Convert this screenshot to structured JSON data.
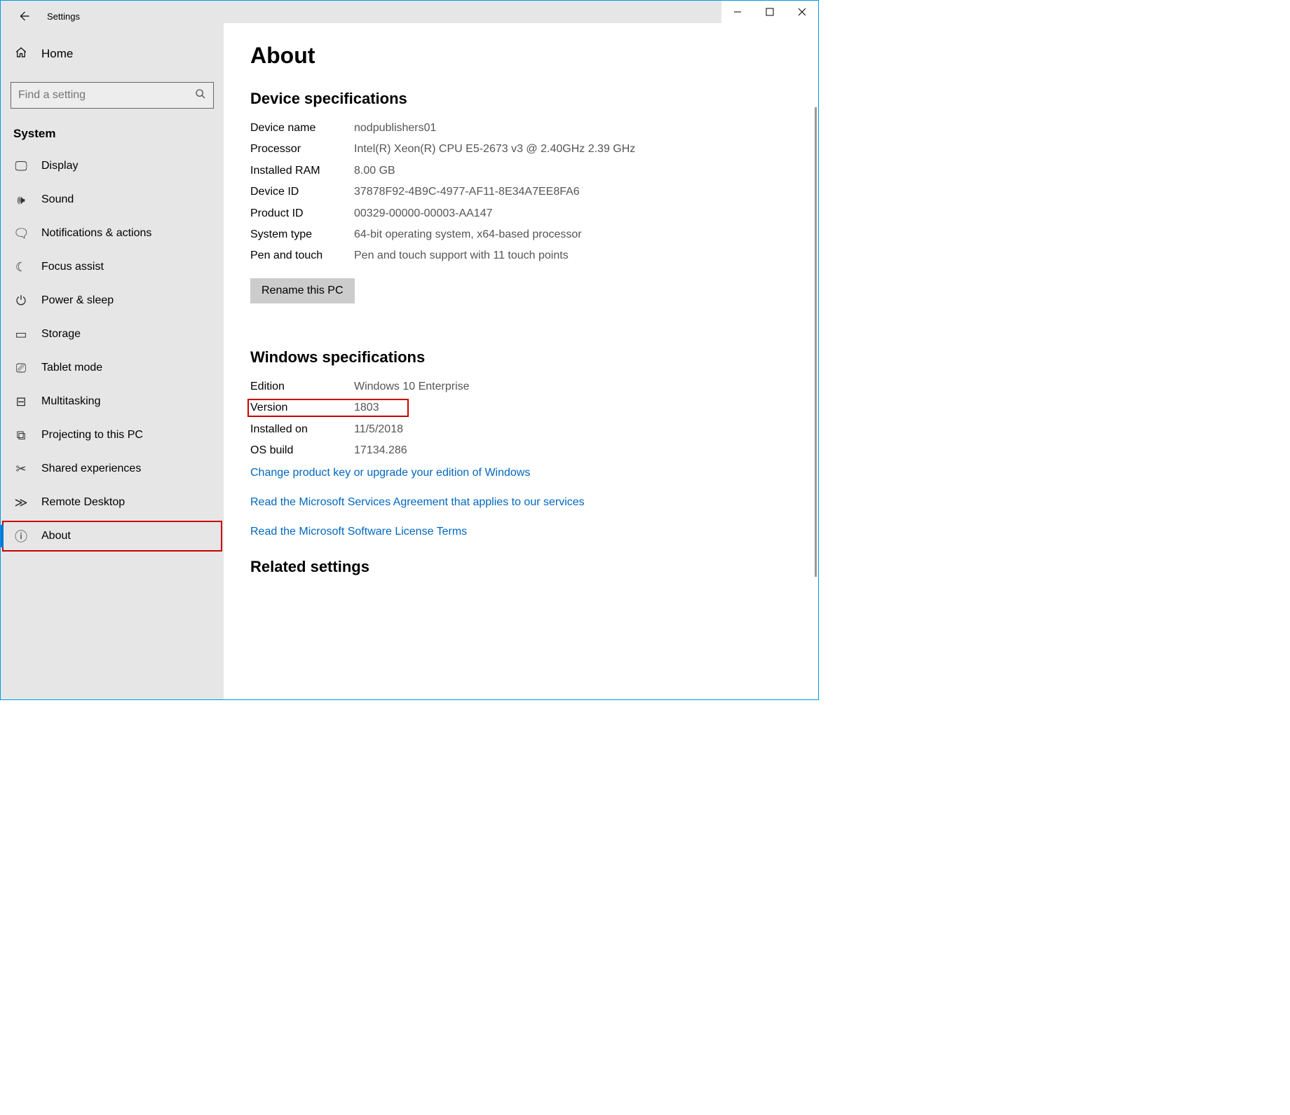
{
  "titlebar": {
    "title": "Settings"
  },
  "sidebar": {
    "home": "Home",
    "search_placeholder": "Find a setting",
    "category": "System",
    "items": [
      {
        "icon": "🖵",
        "label": "Display"
      },
      {
        "icon": "🕪",
        "label": "Sound"
      },
      {
        "icon": "🗨",
        "label": "Notifications & actions"
      },
      {
        "icon": "☾",
        "label": "Focus assist"
      },
      {
        "icon": "⏻",
        "label": "Power & sleep"
      },
      {
        "icon": "▭",
        "label": "Storage"
      },
      {
        "icon": "⎚",
        "label": "Tablet mode"
      },
      {
        "icon": "⊟",
        "label": "Multitasking"
      },
      {
        "icon": "⧉",
        "label": "Projecting to this PC"
      },
      {
        "icon": "✂",
        "label": "Shared experiences"
      },
      {
        "icon": "≫",
        "label": "Remote Desktop"
      },
      {
        "icon": "ⓘ",
        "label": "About",
        "active": true
      }
    ]
  },
  "content": {
    "page_title": "About",
    "device_spec_header": "Device specifications",
    "device": [
      {
        "k": "Device name",
        "v": "nodpublishers01"
      },
      {
        "k": "Processor",
        "v": "Intel(R) Xeon(R) CPU E5-2673 v3 @ 2.40GHz 2.39 GHz"
      },
      {
        "k": "Installed RAM",
        "v": "8.00 GB"
      },
      {
        "k": "Device ID",
        "v": "37878F92-4B9C-4977-AF11-8E34A7EE8FA6"
      },
      {
        "k": "Product ID",
        "v": "00329-00000-00003-AA147"
      },
      {
        "k": "System type",
        "v": "64-bit operating system, x64-based processor"
      },
      {
        "k": "Pen and touch",
        "v": "Pen and touch support with 11 touch points"
      }
    ],
    "rename_btn": "Rename this PC",
    "win_spec_header": "Windows specifications",
    "windows": [
      {
        "k": "Edition",
        "v": "Windows 10 Enterprise"
      },
      {
        "k": "Version",
        "v": "1803",
        "highlight": true
      },
      {
        "k": "Installed on",
        "v": "11/5/2018"
      },
      {
        "k": "OS build",
        "v": "17134.286"
      }
    ],
    "links": [
      "Change product key or upgrade your edition of Windows",
      "Read the Microsoft Services Agreement that applies to our services",
      "Read the Microsoft Software License Terms"
    ],
    "related_header": "Related settings"
  }
}
